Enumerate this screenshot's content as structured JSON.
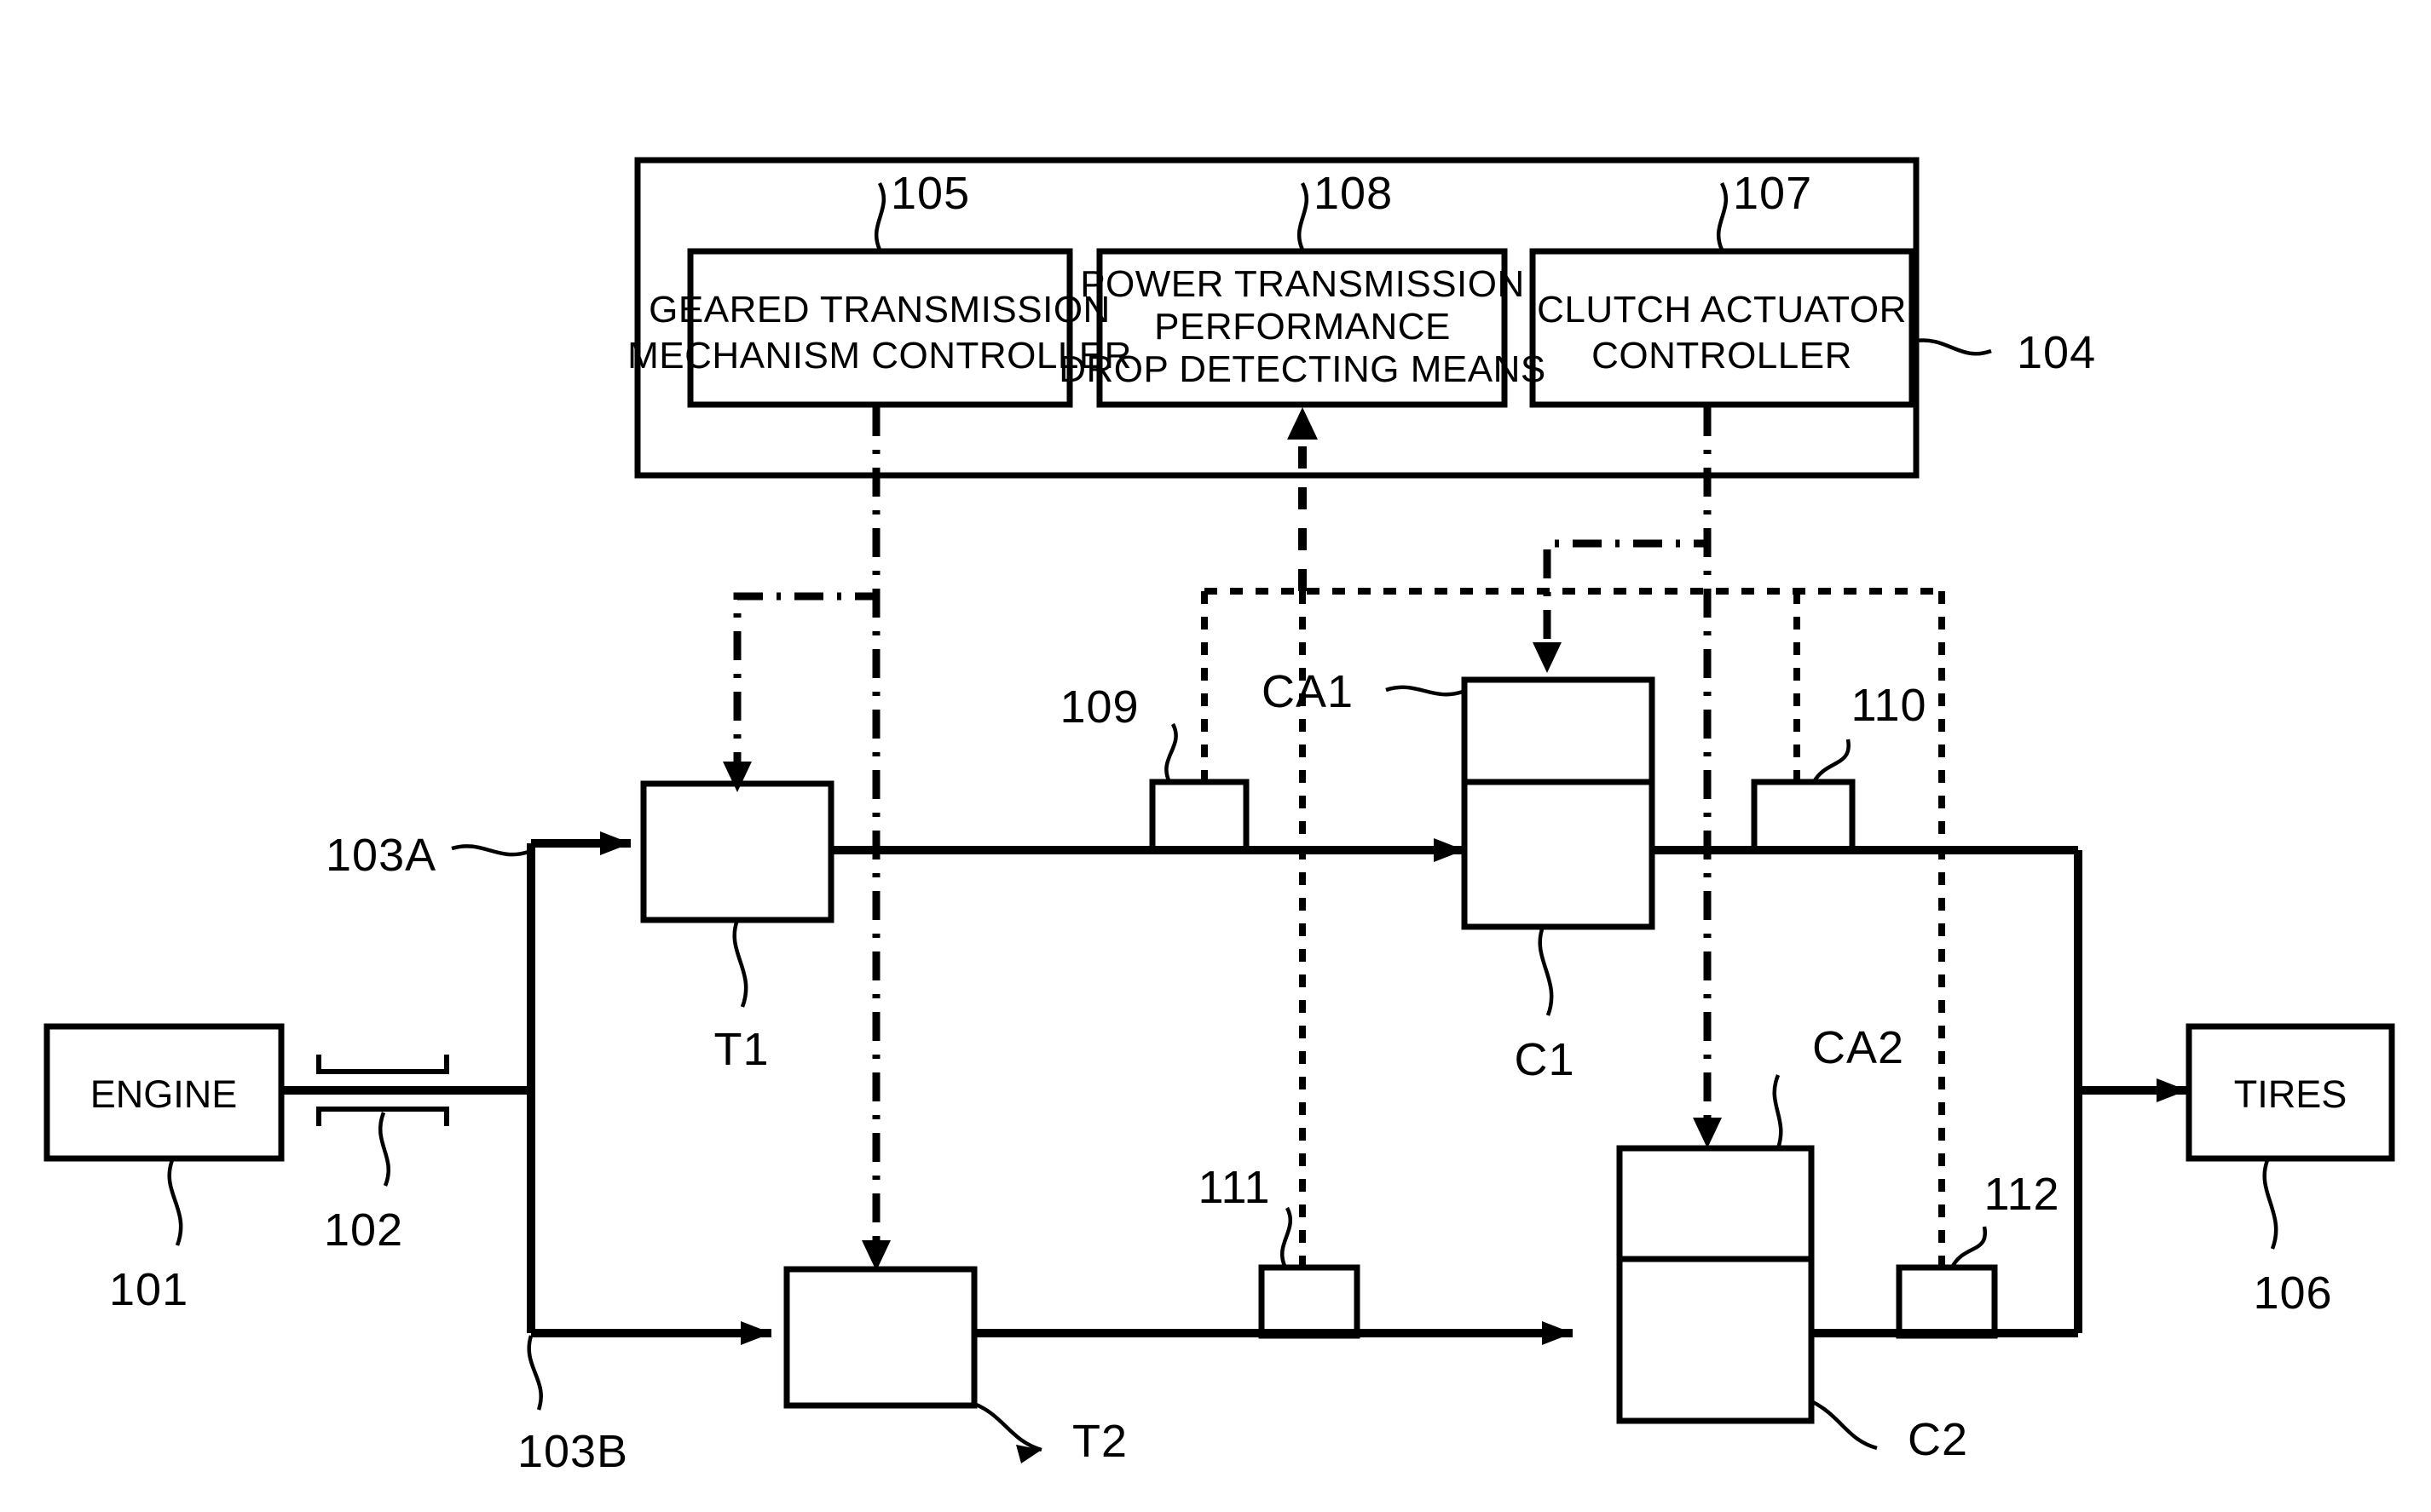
{
  "diagram": {
    "title": "Dual clutch transmission control block diagram",
    "controller_unit": {
      "ref": "104",
      "blocks": [
        {
          "ref": "105",
          "lines": [
            "GEARED TRANSMISSION",
            "MECHANISM CONTROLLER"
          ]
        },
        {
          "ref": "108",
          "lines": [
            "POWER TRANSMISSION",
            "PERFORMANCE",
            "DROP DETECTING MEANS"
          ]
        },
        {
          "ref": "107",
          "lines": [
            "CLUTCH ACTUATOR",
            "CONTROLLER"
          ]
        }
      ]
    },
    "nodes": {
      "engine": {
        "label": "ENGINE",
        "ref": "101"
      },
      "tires": {
        "label": "TIRES",
        "ref": "106"
      },
      "shaft_bracket": {
        "ref": "102"
      },
      "branch_upper": {
        "ref": "103A"
      },
      "branch_lower": {
        "ref": "103B"
      },
      "transmission_1": {
        "label": "T1"
      },
      "transmission_2": {
        "label": "T2"
      },
      "clutch_1": {
        "label": "C1"
      },
      "clutch_2": {
        "label": "C2"
      },
      "clutch_actuator_1": {
        "label": "CA1"
      },
      "clutch_actuator_2": {
        "label": "CA2"
      },
      "sensor_109": {
        "ref": "109"
      },
      "sensor_110": {
        "ref": "110"
      },
      "sensor_111": {
        "ref": "111"
      },
      "sensor_112": {
        "ref": "112"
      }
    },
    "colors": {
      "ink": "#000000",
      "paper": "#ffffff"
    }
  }
}
